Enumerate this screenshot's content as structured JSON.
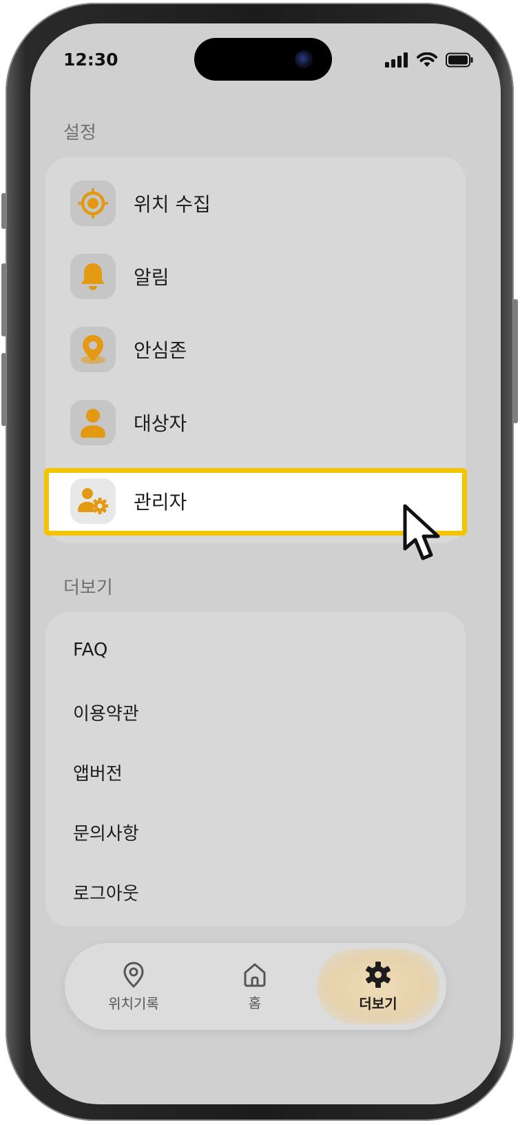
{
  "status_bar": {
    "time": "12:30"
  },
  "settings": {
    "title": "설정",
    "items": [
      {
        "label": "위치 수집",
        "icon": "location-crosshair-icon"
      },
      {
        "label": "알림",
        "icon": "bell-icon"
      },
      {
        "label": "안심존",
        "icon": "map-pin-icon"
      },
      {
        "label": "대상자",
        "icon": "person-icon"
      },
      {
        "label": "관리자",
        "icon": "user-gear-icon",
        "highlighted": true
      }
    ]
  },
  "more": {
    "title": "더보기",
    "items": [
      {
        "label": "FAQ"
      },
      {
        "label": "이용약관"
      },
      {
        "label": "앱버전"
      },
      {
        "label": "문의사항"
      },
      {
        "label": "로그아웃"
      }
    ]
  },
  "tab_bar": {
    "tabs": [
      {
        "label": "위치기록",
        "icon": "location-pin-outline-icon"
      },
      {
        "label": "홈",
        "icon": "home-icon"
      },
      {
        "label": "더보기",
        "icon": "gear-icon",
        "active": true
      }
    ]
  },
  "colors": {
    "accent": "#e39a12",
    "highlight_border": "#f5c400"
  }
}
